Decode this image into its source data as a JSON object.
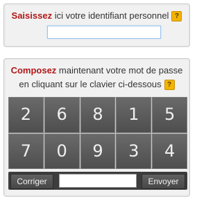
{
  "identifier": {
    "label_bold": "Saisissez",
    "label_rest": " ici votre identifiant personnel",
    "help_icon": "question-mark-icon",
    "help_text": "?",
    "input_value": ""
  },
  "password": {
    "label_bold": "Composez",
    "label_rest1": " maintenant votre mot de passe",
    "label_line2": "en cliquant sur le clavier ci-dessous",
    "help_text": "?",
    "input_value": ""
  },
  "keypad": {
    "keys": [
      "2",
      "6",
      "8",
      "1",
      "5",
      "7",
      "0",
      "9",
      "3",
      "4"
    ]
  },
  "buttons": {
    "clear_label": "Corriger",
    "submit_label": "Envoyer"
  },
  "colors": {
    "accent_red": "#b01818",
    "help_yellow": "#f2b400",
    "key_gray": "#5a5a5a"
  }
}
